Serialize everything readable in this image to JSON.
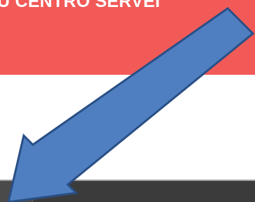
{
  "banner": {
    "title": "U CENTRO SERVEI"
  },
  "colors": {
    "banner": "#f25a58",
    "arrow_fill": "#4f7fc0",
    "arrow_stroke": "#2a4f86",
    "bottom_bar": "#3b3b3b"
  },
  "overlay": {
    "arrow_icon": "arrow-down-left-icon"
  }
}
